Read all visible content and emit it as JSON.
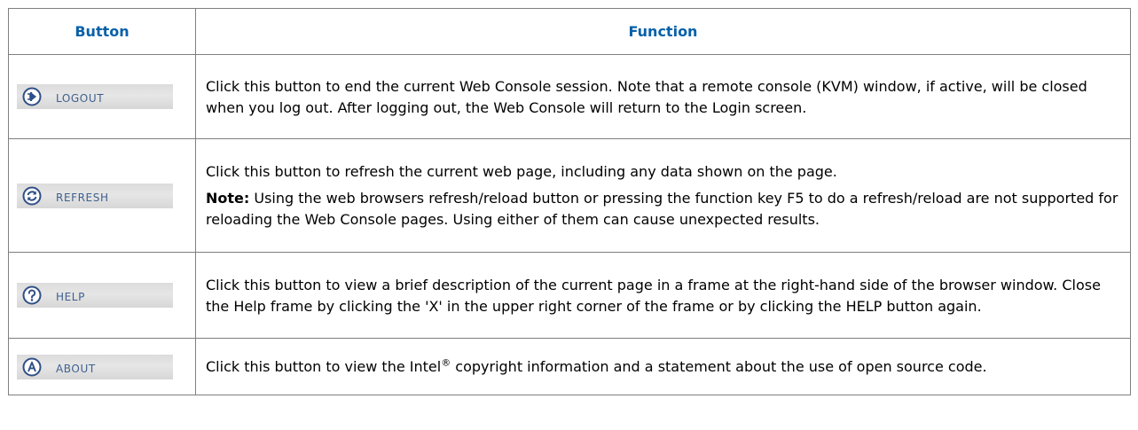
{
  "table": {
    "headers": {
      "button": "Button",
      "function": "Function"
    },
    "rows": [
      {
        "button_label": "LOGOUT",
        "icon": "logout-icon",
        "description": "Click this button to end the current Web Console session. Note that a remote console (KVM) window, if active, will be closed when you log out. After logging out, the Web Console will return to the Login screen."
      },
      {
        "button_label": "REFRESH",
        "icon": "refresh-icon",
        "description": "Click this button to refresh the current web page, including any data shown on the page.",
        "note_label": "Note:",
        "note_text": " Using the web browsers refresh/reload button or pressing the function key F5 to do a refresh/reload are not supported for reloading the Web Console pages. Using either of them can cause unexpected results."
      },
      {
        "button_label": "HELP",
        "icon": "help-icon",
        "description": "Click this button to view a brief description of the current page in a frame at the right-hand side of the browser window. Close the Help frame by clicking the 'X' in the upper right corner of the frame or by clicking the HELP button again."
      },
      {
        "button_label": "ABOUT",
        "icon": "about-icon",
        "description_before": "Click this button to view the Intel",
        "registered_mark": "®",
        "description_after": " copyright information and a statement about the use of open source code."
      }
    ]
  },
  "colors": {
    "header_text": "#0860a8",
    "button_label": "#3e5f8e",
    "icon": "#2f4f86",
    "border": "#7f7f7f"
  }
}
